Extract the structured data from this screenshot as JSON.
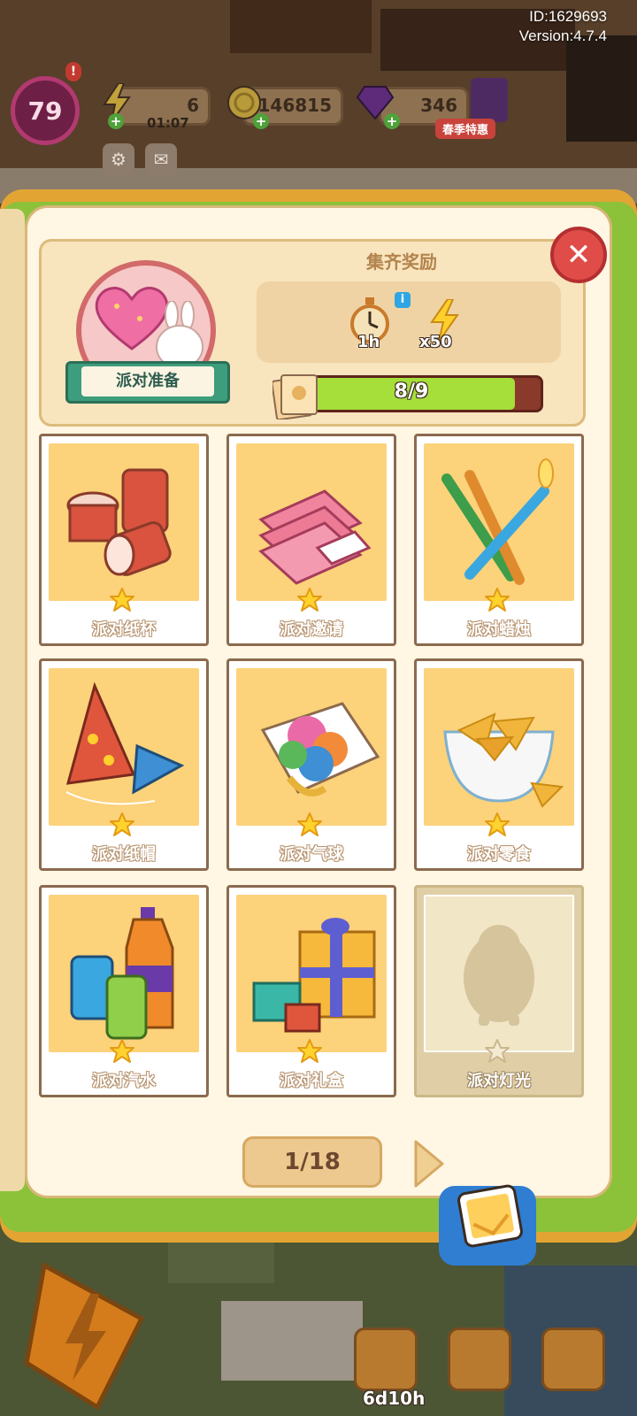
{
  "build": {
    "id": "ID:1629693",
    "version": "Version:4.7.4"
  },
  "hud": {
    "level": "79",
    "level_alert": "!",
    "energy": "6",
    "energy_timer": "01:07",
    "coins": "146815",
    "gems": "346",
    "shop_label": "春季特惠"
  },
  "reward": {
    "set_name": "派对准备",
    "title": "集齐奖励",
    "info_badge": "i",
    "time_reward": "1h",
    "energy_reward": "x50",
    "progress_text": "8/9",
    "progress_fraction": 0.889
  },
  "cards": [
    {
      "name": "派对纸杯",
      "collected": true
    },
    {
      "name": "派对邀请",
      "collected": true
    },
    {
      "name": "派对蜡烛",
      "collected": true
    },
    {
      "name": "派对纸帽",
      "collected": true
    },
    {
      "name": "派对气球",
      "collected": true
    },
    {
      "name": "派对零食",
      "collected": true
    },
    {
      "name": "派对汽水",
      "collected": true
    },
    {
      "name": "派对礼盒",
      "collected": true
    },
    {
      "name": "派对灯光",
      "collected": false
    }
  ],
  "pager": {
    "label": "1/18"
  },
  "bottom": {
    "event_timer": "6d10h"
  },
  "colors": {
    "panel": "#fff6e3",
    "progress_fill": "#a6de3a",
    "close": "#e04c47",
    "card_art": "#fcd27a"
  }
}
